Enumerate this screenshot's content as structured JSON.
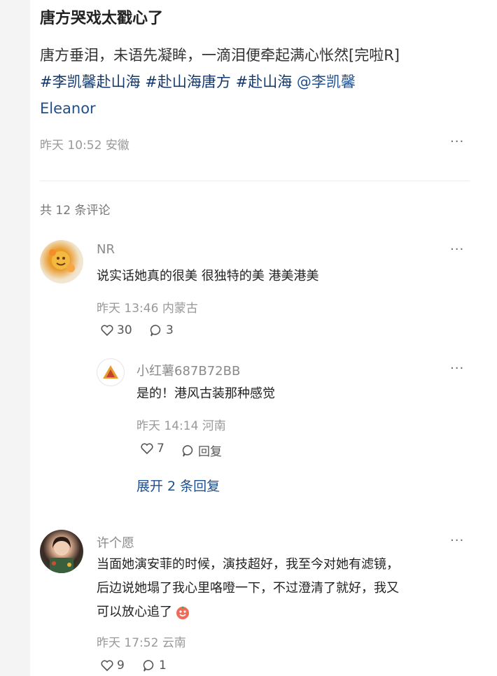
{
  "post": {
    "title": "唐方哭戏太戳心了",
    "text": "唐方垂泪，未语先凝眸，一滴泪便牵起满心怅然[完啦R]",
    "tags": [
      "#李凯馨赴山海",
      "#赴山海唐方",
      "#赴山海",
      "@李凯馨"
    ],
    "tag_cont": "Eleanor",
    "time": "昨天 10:52",
    "location": "安徽",
    "more": "···"
  },
  "comments_count": "共 12 条评论",
  "comments": [
    {
      "name": "NR",
      "text": "说实话她真的很美 很独特的美 港美港美",
      "time": "昨天 13:46",
      "location": "内蒙古",
      "likes": "30",
      "replies": "3",
      "more": "···"
    },
    {
      "name": "小红薯687B72BB",
      "text": "是的！港风古装那种感觉",
      "time": "昨天 14:14",
      "location": "河南",
      "likes": "7",
      "reply_label": "回复",
      "more": "···"
    },
    {
      "name": "许个愿",
      "text_lines": [
        "当面她演安菲的时候，演技超好，我至今对她有滤镜，",
        "后边说她塌了我心里咯噔一下，不过澄清了就好，我又",
        "可以放心追了"
      ],
      "time": "昨天 17:52",
      "location": "云南",
      "likes": "9",
      "replies": "1",
      "more": "···"
    }
  ],
  "expand_label": "展开 2 条回复",
  "colors": {
    "link": "#1f4e8c",
    "meta": "#999999",
    "background": "#f4f4f4"
  },
  "icons": [
    "heart-icon",
    "comment-bubble-icon",
    "more-dots-icon",
    "emoji-icon"
  ]
}
